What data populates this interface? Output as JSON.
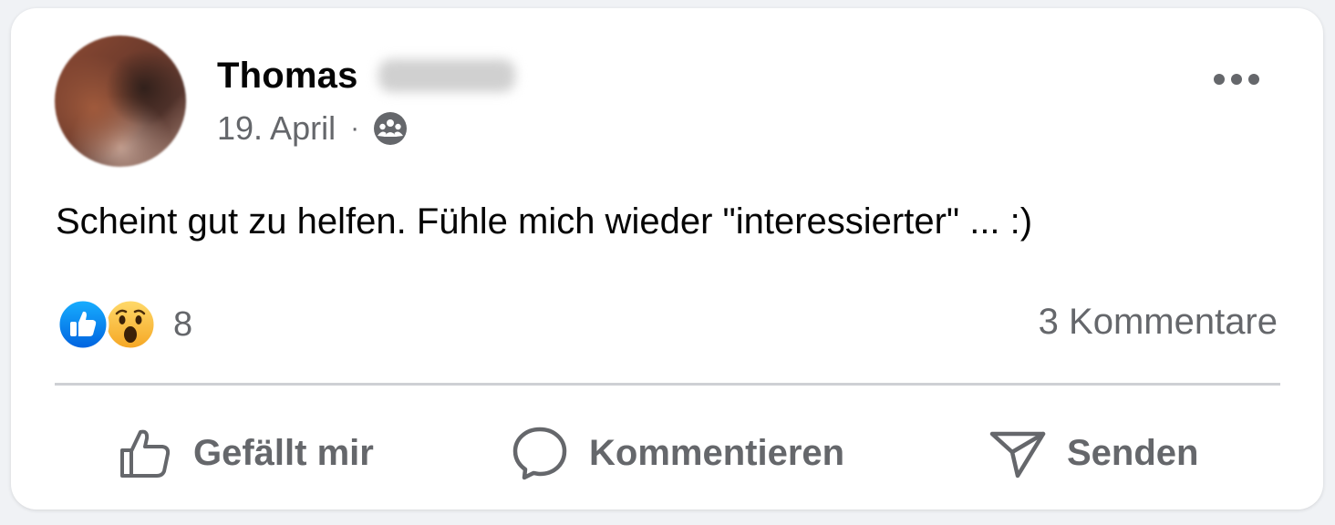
{
  "post": {
    "author": {
      "first_name": "Thomas",
      "avatar_icon": "avatar-photo-blurred"
    },
    "date": "19. April",
    "separator": "·",
    "audience_icon": "friends-group-icon",
    "more_icon": "more-options-icon",
    "text": "Scheint gut zu helfen. Fühle mich wieder \"interessierter\" ... :)",
    "reactions": {
      "icons": [
        "like-icon",
        "wow-icon"
      ],
      "count": "8"
    },
    "comments_label": "3 Kommentare",
    "actions": {
      "like": "Gefällt mir",
      "comment": "Kommentieren",
      "send": "Senden"
    }
  },
  "colors": {
    "like_blue": "#1877f2",
    "secondary_text": "#65676b",
    "primary_text": "#050505",
    "divider": "#ced0d4"
  }
}
